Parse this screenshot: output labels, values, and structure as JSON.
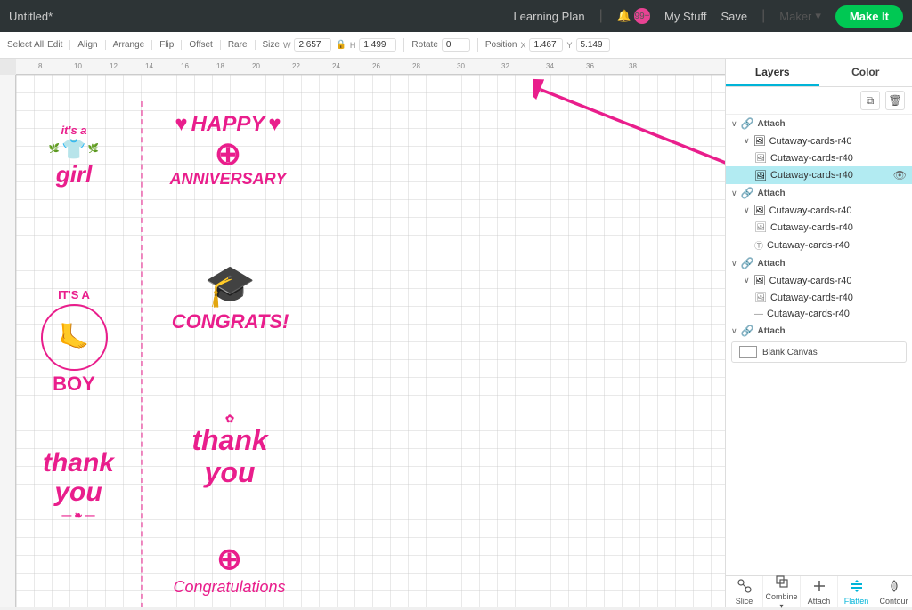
{
  "header": {
    "title": "Untitled*",
    "nav": {
      "learning_plan": "Learning Plan",
      "my_stuff": "My Stuff",
      "save": "Save",
      "maker": "Maker",
      "make_it": "Make It",
      "notification_count": "99+"
    }
  },
  "toolbar": {
    "select_all": "Select All",
    "edit": "Edit",
    "align": "Align",
    "arrange": "Arrange",
    "flip": "Flip",
    "offset": "Offset",
    "rare": "Rare",
    "size_label": "Size",
    "width": "2.657",
    "height": "1.499",
    "rotate_label": "Rotate",
    "rotate": "0",
    "position_label": "Position",
    "x": "1.467",
    "y": "5.149"
  },
  "canvas": {
    "designs": [
      {
        "id": "its-a-girl",
        "label": "it's a girl"
      },
      {
        "id": "happy-anniversary",
        "label": "Happy Anniversary"
      },
      {
        "id": "its-a-boy",
        "label": "IT'S A BOY"
      },
      {
        "id": "congrats",
        "label": "CONGRATS!"
      },
      {
        "id": "thank-you-left",
        "label": "thank you"
      },
      {
        "id": "thank-you-right",
        "label": "thank you"
      },
      {
        "id": "congratulations",
        "label": "Congratulations"
      }
    ]
  },
  "layers_panel": {
    "tabs": [
      "Layers",
      "Color"
    ],
    "active_tab": "Layers",
    "groups": [
      {
        "type": "attach",
        "label": "Attach",
        "items": [
          {
            "name": "Cutaway-cards-r40",
            "level": 1,
            "icon": "image"
          },
          {
            "name": "Cutaway-cards-r40",
            "level": 2,
            "icon": "image"
          },
          {
            "name": "Cutaway-cards-r40",
            "level": 2,
            "icon": "image",
            "active": true,
            "eye": true
          }
        ]
      },
      {
        "type": "attach",
        "label": "Attach",
        "items": [
          {
            "name": "Cutaway-cards-r40",
            "level": 1,
            "icon": "image"
          },
          {
            "name": "Cutaway-cards-r40",
            "level": 2,
            "icon": "image"
          },
          {
            "name": "Cutaway-cards-r40",
            "level": 2,
            "icon": "text"
          }
        ]
      },
      {
        "type": "attach",
        "label": "Attach",
        "items": [
          {
            "name": "Cutaway-cards-r40",
            "level": 1,
            "icon": "image"
          },
          {
            "name": "Cutaway-cards-r40",
            "level": 2,
            "icon": "image"
          },
          {
            "name": "Cutaway-cards-r40",
            "level": 2,
            "icon": "line"
          }
        ]
      },
      {
        "type": "attach",
        "label": "Attach",
        "items": [
          {
            "name": "Blank Canvas",
            "level": 0,
            "icon": "canvas",
            "thumb": true
          }
        ]
      }
    ],
    "bottom_buttons": [
      "Slice",
      "Combine",
      "Attach",
      "Flatten",
      "Contour"
    ]
  },
  "icons": {
    "chevron_right": "›",
    "chevron_down": "∨",
    "eye": "👁",
    "duplicate": "⧉",
    "trash": "🗑",
    "attach": "🔗"
  },
  "colors": {
    "pink": "#e91e8c",
    "accent_tab": "#00b4d8",
    "active_layer": "#b2ebf2",
    "make_it_green": "#00c853",
    "header_bg": "#2d3436"
  }
}
